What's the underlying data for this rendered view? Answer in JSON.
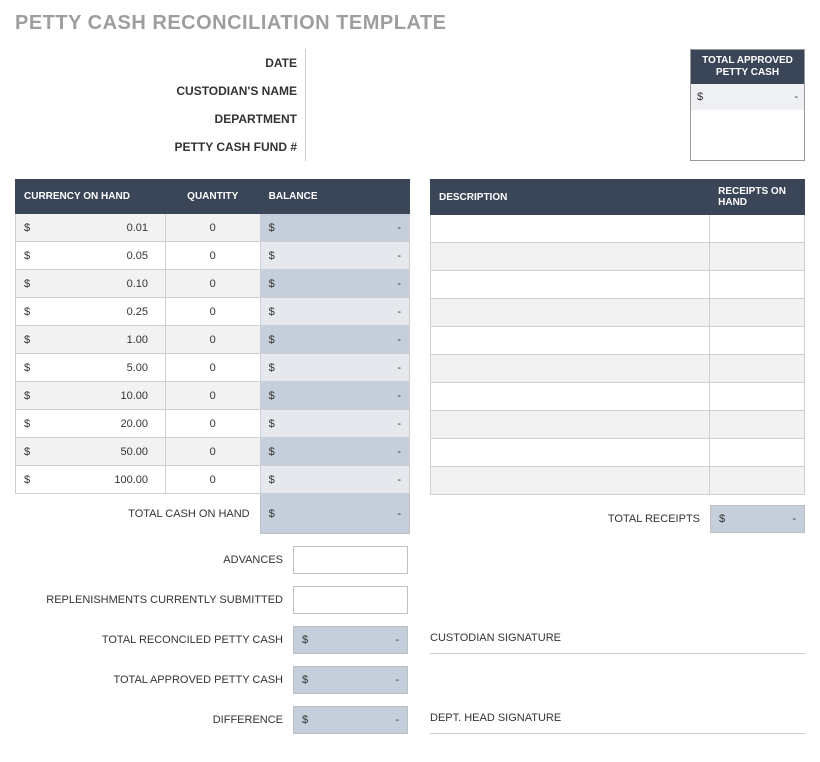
{
  "title": "PETTY CASH RECONCILIATION TEMPLATE",
  "meta": {
    "date_label": "DATE",
    "custodian_label": "CUSTODIAN'S NAME",
    "department_label": "DEPARTMENT",
    "fund_label": "PETTY CASH FUND #"
  },
  "approved_box": {
    "header": "TOTAL APPROVED PETTY CASH",
    "dollar": "$",
    "value": "-"
  },
  "currency_table": {
    "headers": {
      "currency": "CURRENCY ON HAND",
      "quantity": "QUANTITY",
      "balance": "BALANCE"
    },
    "dollar": "$",
    "rows": [
      {
        "denom": "0.01",
        "qty": "0",
        "bal": "-"
      },
      {
        "denom": "0.05",
        "qty": "0",
        "bal": "-"
      },
      {
        "denom": "0.10",
        "qty": "0",
        "bal": "-"
      },
      {
        "denom": "0.25",
        "qty": "0",
        "bal": "-"
      },
      {
        "denom": "1.00",
        "qty": "0",
        "bal": "-"
      },
      {
        "denom": "5.00",
        "qty": "0",
        "bal": "-"
      },
      {
        "denom": "10.00",
        "qty": "0",
        "bal": "-"
      },
      {
        "denom": "20.00",
        "qty": "0",
        "bal": "-"
      },
      {
        "denom": "50.00",
        "qty": "0",
        "bal": "-"
      },
      {
        "denom": "100.00",
        "qty": "0",
        "bal": "-"
      }
    ]
  },
  "receipts_table": {
    "headers": {
      "description": "DESCRIPTION",
      "receipts": "RECEIPTS ON HAND"
    },
    "row_count": 10
  },
  "summary": {
    "total_cash_label": "TOTAL CASH ON HAND",
    "total_cash_value": "-",
    "advances_label": "ADVANCES",
    "replenishments_label": "REPLENISHMENTS CURRENTLY SUBMITTED",
    "reconciled_label": "TOTAL RECONCILED PETTY CASH",
    "reconciled_value": "-",
    "approved_label": "TOTAL APPROVED PETTY CASH",
    "approved_value": "-",
    "difference_label": "DIFFERENCE",
    "difference_value": "-",
    "total_receipts_label": "TOTAL RECEIPTS",
    "total_receipts_value": "-",
    "dollar": "$"
  },
  "signatures": {
    "custodian": "CUSTODIAN SIGNATURE",
    "dept_head": "DEPT. HEAD SIGNATURE"
  }
}
